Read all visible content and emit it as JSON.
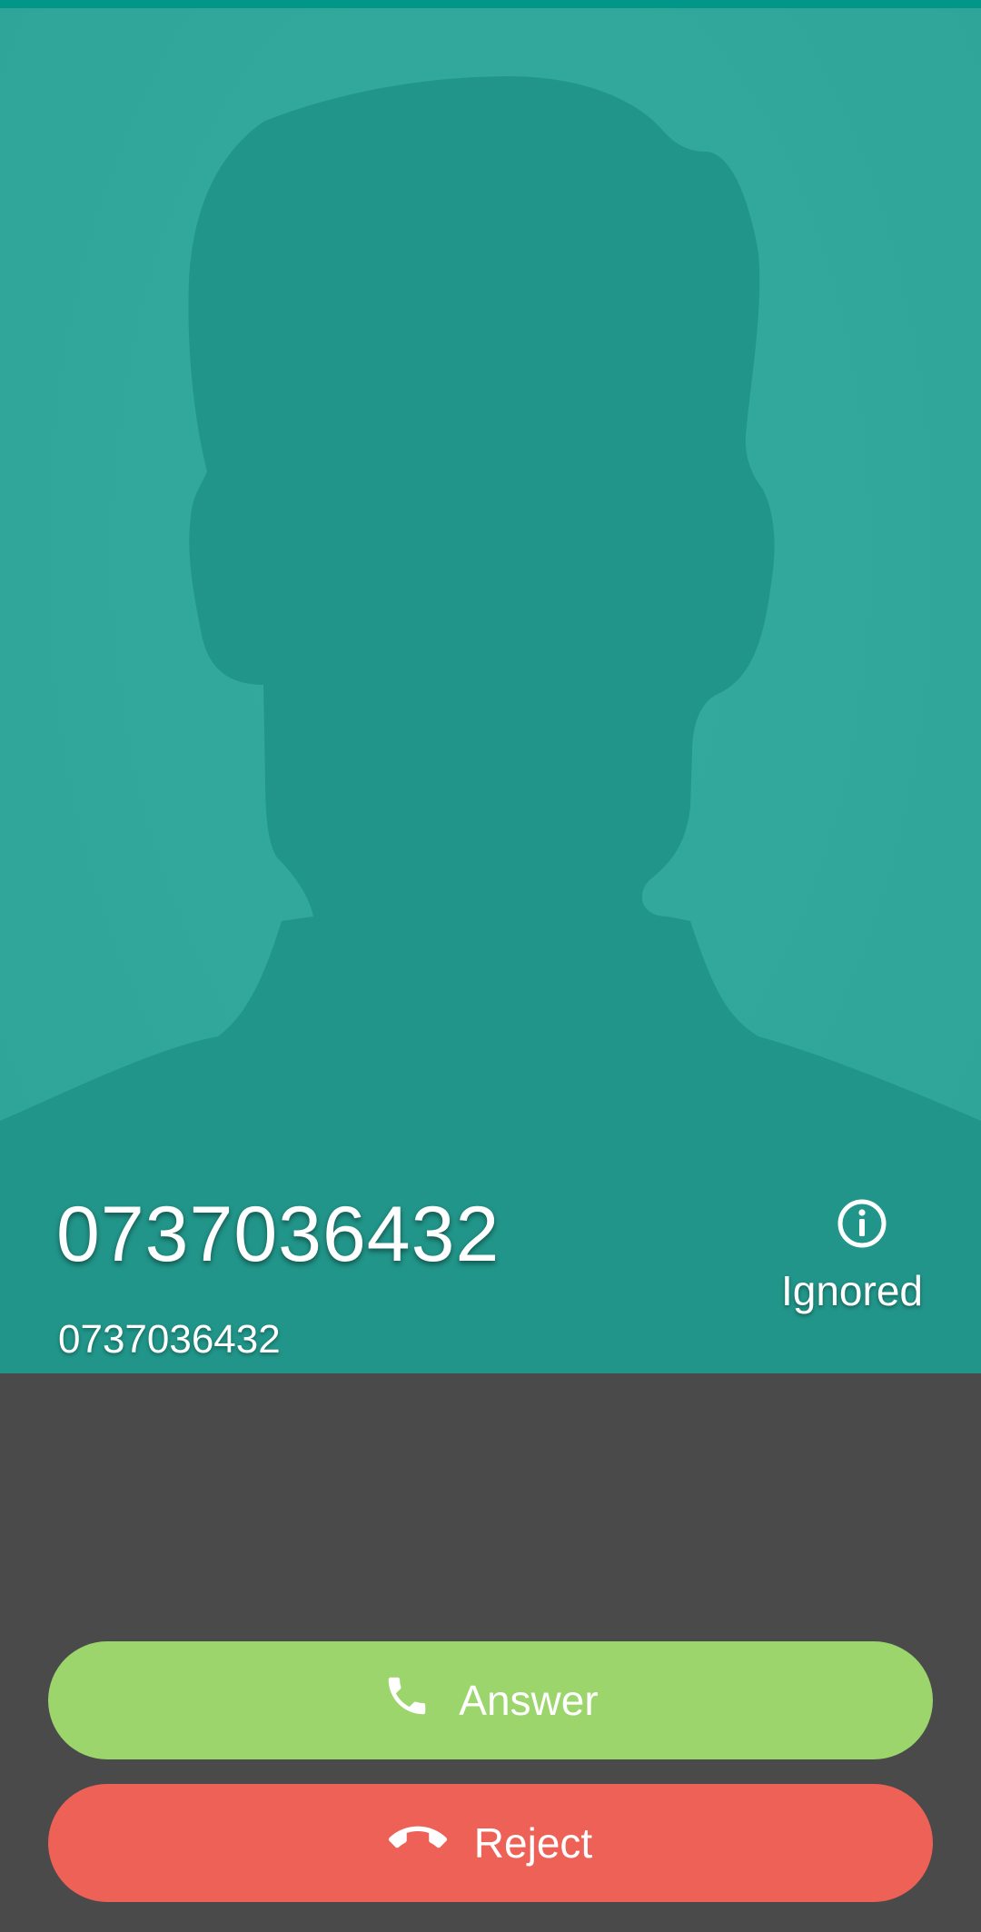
{
  "caller": {
    "name": "0737036432",
    "number": "0737036432"
  },
  "call_status": {
    "icon": "info-icon",
    "label": "Ignored"
  },
  "actions": {
    "answer": {
      "label": "Answer",
      "icon": "phone-icon",
      "color": "#9bd56b"
    },
    "reject": {
      "label": "Reject",
      "icon": "hang-up-icon",
      "color": "#ee6157"
    }
  },
  "colors": {
    "status_bar": "#009688",
    "caller_background": "#31a89b",
    "silhouette": "#219589",
    "bottom_panel": "#4a4a4a"
  }
}
